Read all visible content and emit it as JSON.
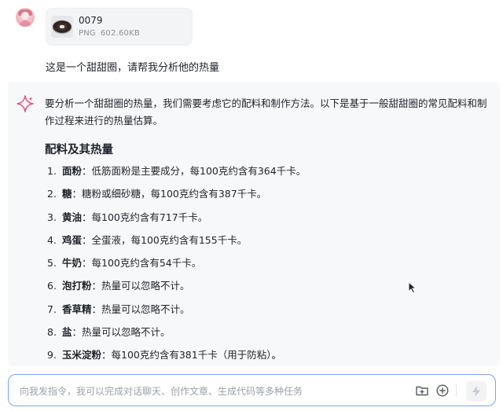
{
  "user_message": {
    "attachment": {
      "name": "0079",
      "type": "PNG",
      "size": "602.60KB"
    },
    "text": "这是一个甜甜圈，请帮我分析他的热量"
  },
  "assistant_message": {
    "intro": "要分析一个甜甜圈的热量，我们需要考虑它的配料和制作方法。以下是基于一般甜甜圈的常见配料和制作过程来进行的热量估算。",
    "section_title": "配料及其热量",
    "items": [
      {
        "num": "1.",
        "label": "面粉",
        "text": "：低筋面粉是主要成分，每100克约含有364千卡。"
      },
      {
        "num": "2.",
        "label": "糖",
        "text": "：糖粉或细砂糖，每100克约含有387千卡。"
      },
      {
        "num": "3.",
        "label": "黄油",
        "text": "：每100克约含有717千卡。"
      },
      {
        "num": "4.",
        "label": "鸡蛋",
        "text": "：全蛋液，每100克约含有155千卡。"
      },
      {
        "num": "5.",
        "label": "牛奶",
        "text": "：每100克约含有54千卡。"
      },
      {
        "num": "6.",
        "label": "泡打粉",
        "text": "：热量可以忽略不计。"
      },
      {
        "num": "7.",
        "label": "香草精",
        "text": "：热量可以忽略不计。"
      },
      {
        "num": "8.",
        "label": "盐",
        "text": "：热量可以忽略不计。"
      },
      {
        "num": "9.",
        "label": "玉米淀粉",
        "text": "：每100克约含有381千卡（用于防粘）。"
      }
    ]
  },
  "input": {
    "placeholder": "向我发指令，我可以完成对话聊天、创作文章、生成代码等多种任务"
  },
  "icons": {
    "avatar": "user-avatar",
    "sparkle": "sparkle-icon",
    "folder": "folder-upload-icon",
    "add": "plus-circle-icon",
    "send": "lightning-icon",
    "cursor": "mouse-cursor-icon"
  },
  "colors": {
    "accent": "#7aa2f7",
    "sparkle": "#e0567a",
    "panel_bg": "#f7f8fa"
  }
}
